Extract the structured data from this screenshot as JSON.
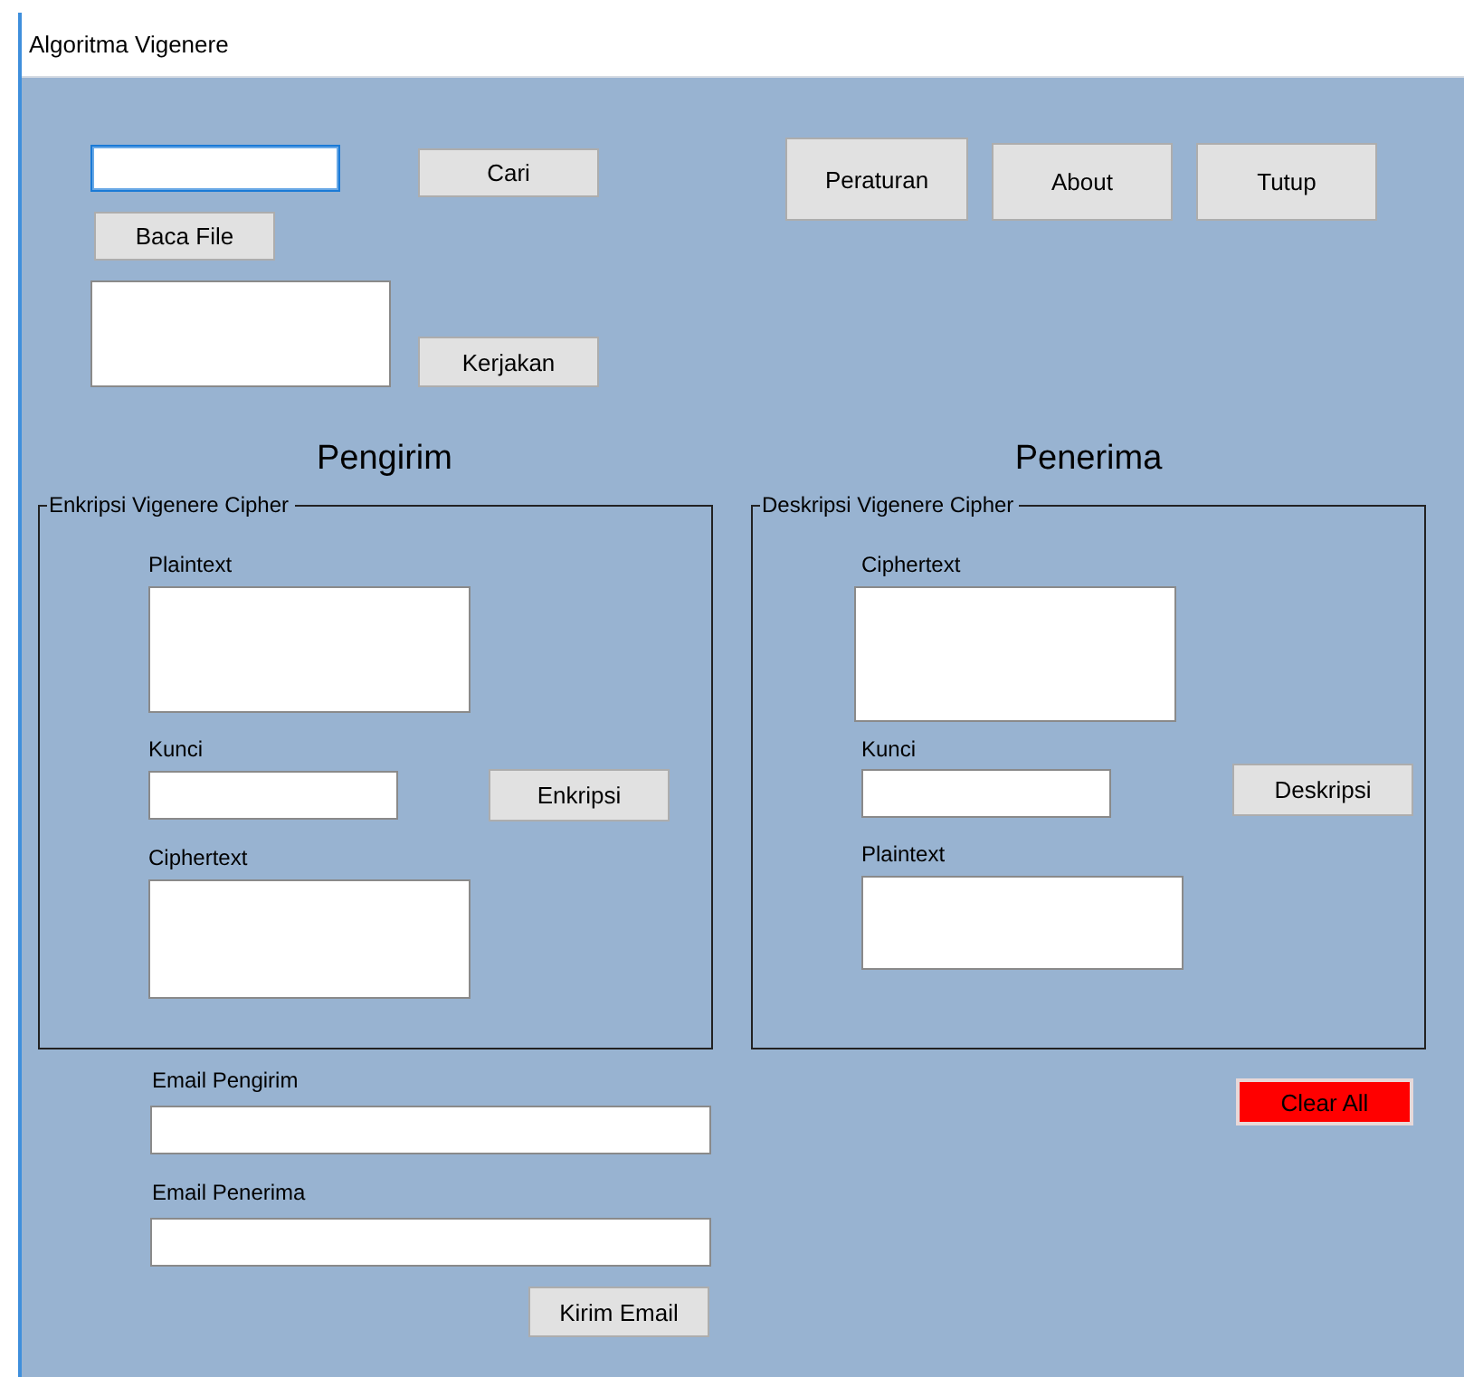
{
  "window": {
    "title": "Algoritma Vigenere"
  },
  "file_panel": {
    "path_field": {
      "focused": true
    },
    "search_button": "Cari",
    "read_button": "Baca File",
    "process_button": "Kerjakan"
  },
  "top_buttons": [
    "Peraturan",
    "About",
    "Tutup"
  ],
  "sections": [
    {
      "heading": "Pengirim",
      "group": "Enkripsi Vigenere Cipher",
      "button": "Enkripsi",
      "fields": [
        {
          "label": "Plaintext",
          "kind": "textarea"
        },
        {
          "label": "Kunci",
          "kind": "input"
        },
        {
          "label": "Ciphertext",
          "kind": "textarea"
        }
      ]
    },
    {
      "heading": "Penerima",
      "group": "Deskripsi Vigenere Cipher",
      "button": "Deskripsi",
      "fields": [
        {
          "label": "Ciphertext",
          "kind": "textarea"
        },
        {
          "label": "Kunci",
          "kind": "input"
        },
        {
          "label": "Plaintext",
          "kind": "textarea"
        }
      ]
    }
  ],
  "email": {
    "fields": [
      {
        "label": "Email Pengirim"
      },
      {
        "label": "Email Penerima"
      }
    ],
    "send_button": "Kirim Email"
  },
  "clear_button": "Clear All"
}
